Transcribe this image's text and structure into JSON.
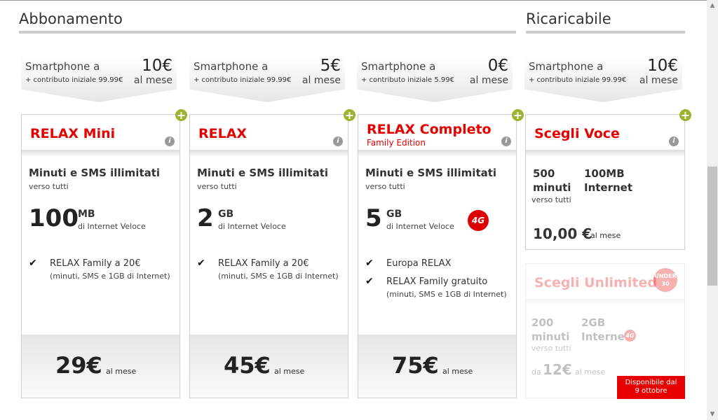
{
  "sections": {
    "abbonamento": "Abbonamento",
    "ricaricabile": "Ricaricabile"
  },
  "tiers": [
    {
      "label": "Smartphone a",
      "contrib": "+ contributo iniziale 99.99€",
      "price": "10€",
      "per": "al mese"
    },
    {
      "label": "Smartphone a",
      "contrib": "+ contributo iniziale 99.99€",
      "price": "5€",
      "per": "al mese"
    },
    {
      "label": "Smartphone a",
      "contrib": "+ contributo iniziale 5.99€",
      "price": "0€",
      "per": "al mese"
    },
    {
      "label": "Smartphone a",
      "contrib": "+ contributo iniziale 99.99€",
      "price": "10€",
      "per": "al mese"
    }
  ],
  "plans": [
    {
      "title": "RELAX Mini",
      "h1": "Minuti e SMS illimitati",
      "sub": "verso tutti",
      "amount": "100",
      "unit": "MB",
      "inet": "di Internet Veloce",
      "f1": "RELAX Family a 20€",
      "f1b": "(minuti, SMS e 1GB di Internet)",
      "price": "29€",
      "per": "al mese"
    },
    {
      "title": "RELAX",
      "h1": "Minuti e SMS illimitati",
      "sub": "verso tutti",
      "amount": "2",
      "unit": "GB",
      "inet": "di Internet Veloce",
      "f1": "RELAX Family a 20€",
      "f1b": "(minuti, SMS e 1GB di Internet)",
      "price": "45€",
      "per": "al mese"
    },
    {
      "title": "RELAX Completo",
      "family": "Family Edition",
      "h1": "Minuti e SMS illimitati",
      "sub": "verso tutti",
      "amount": "5",
      "unit": "GB",
      "inet": "di Internet Veloce",
      "badge": "4G",
      "f1": "Europa RELAX",
      "f2": "RELAX Family gratuito",
      "f2b": "(minuti, SMS e 1GB di Internet)",
      "price": "75€",
      "per": "al mese"
    }
  ],
  "voce": {
    "title": "Scegli Voce",
    "min": "500",
    "min2": "minuti",
    "verso": "verso tutti",
    "mb": "100MB",
    "inet": "Internet",
    "price": "10,00 €",
    "per": "al mese"
  },
  "unlimited": {
    "title": "Scegli Unlimited",
    "under_a": "UNDER",
    "under_b": "30",
    "min": "200",
    "min2": "minuti",
    "verso": "verso tutti",
    "gb": "2GB",
    "inet": "Internet",
    "badge": "4G",
    "da": "da",
    "price": "12€",
    "per": "al mese",
    "disp_a": "Disponibile dal",
    "disp_b": "9 ottobre"
  },
  "colors": {
    "accent": "#e60000",
    "plus": "#9ab52d"
  },
  "icons": {
    "plus": "+",
    "info": "i",
    "check": "✔"
  }
}
